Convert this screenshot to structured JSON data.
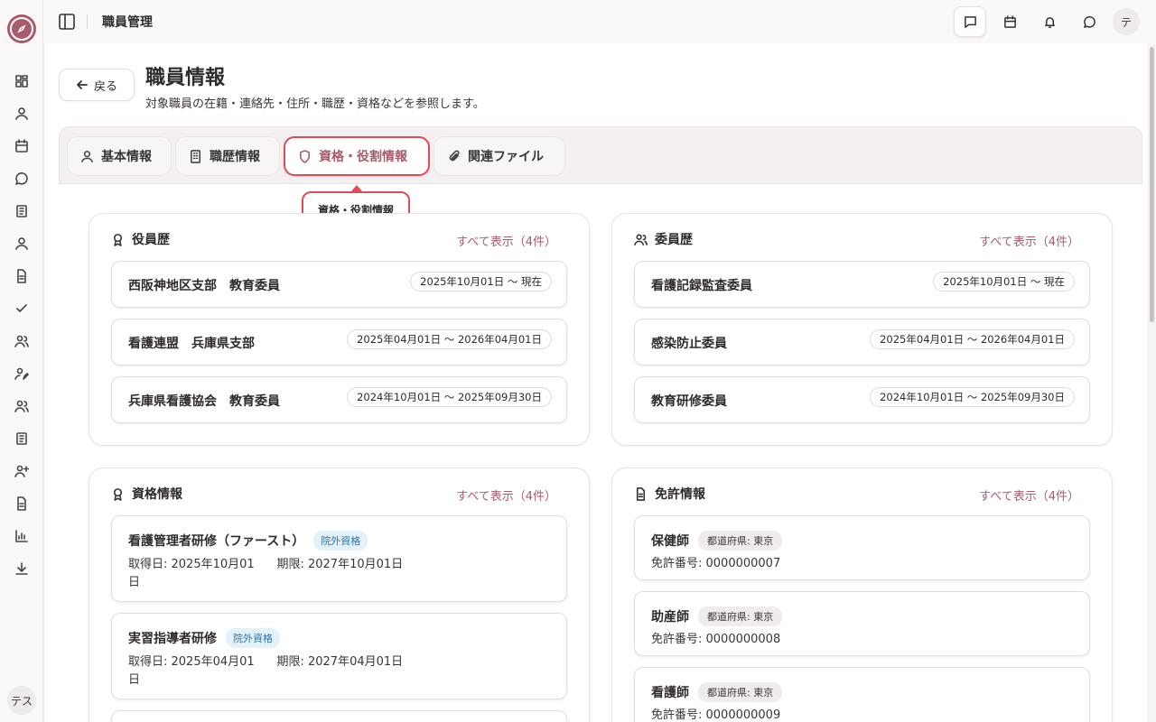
{
  "topbar": {
    "title": "職員管理",
    "avatar": "テ"
  },
  "rail": {
    "avatar": "テス"
  },
  "page": {
    "back_label": "戻る",
    "title": "職員情報",
    "description": "対象職員の在籍・連絡先・住所・職歴・資格などを参照します。"
  },
  "tabs": [
    {
      "label": "基本情報",
      "icon": "user-icon"
    },
    {
      "label": "職歴情報",
      "icon": "building-icon"
    },
    {
      "label": "資格・役割情報",
      "icon": "shield-icon",
      "active": true
    },
    {
      "label": "関連ファイル",
      "icon": "paperclip-icon"
    }
  ],
  "tooltip": "資格・役割情報",
  "officer": {
    "title": "役員歴",
    "link": "すべて表示（4件）",
    "items": [
      {
        "name": "西阪神地区支部　教育委員",
        "period": "2025年10月01日 〜 現在"
      },
      {
        "name": "看護連盟　兵庫県支部",
        "period": "2025年04月01日 〜 2026年04月01日"
      },
      {
        "name": "兵庫県看護協会　教育委員",
        "period": "2024年10月01日 〜 2025年09月30日"
      }
    ]
  },
  "committee": {
    "title": "委員歴",
    "link": "すべて表示（4件）",
    "items": [
      {
        "name": "看護記録監査委員",
        "period": "2025年10月01日 〜 現在"
      },
      {
        "name": "感染防止委員",
        "period": "2025年04月01日 〜 2026年04月01日"
      },
      {
        "name": "教育研修委員",
        "period": "2024年10月01日 〜 2025年09月30日"
      }
    ]
  },
  "qualification": {
    "title": "資格情報",
    "link": "すべて表示（4件）",
    "items": [
      {
        "name": "看護管理者研修（ファースト）",
        "badge": "院外資格",
        "acquired": "取得日: 2025年10月01",
        "expiry": "期限: 2027年10月01日",
        "wrap": "日"
      },
      {
        "name": "実習指導者研修",
        "badge": "院外資格",
        "acquired": "取得日: 2025年04月01",
        "expiry": "期限: 2027年04月01日",
        "wrap": "日"
      }
    ]
  },
  "license": {
    "title": "免許情報",
    "link": "すべて表示（4件）",
    "items": [
      {
        "name": "保健師",
        "badge": "都道府県: 東京",
        "number": "免許番号: 0000000007"
      },
      {
        "name": "助産師",
        "badge": "都道府県: 東京",
        "number": "免許番号: 0000000008"
      },
      {
        "name": "看護師",
        "badge": "都道府県: 東京",
        "number": "免許番号: 0000000009"
      }
    ]
  },
  "colors": {
    "accent": "#a85d6c",
    "highlight": "#e24a56",
    "badge_blue": "#2a74a7"
  }
}
